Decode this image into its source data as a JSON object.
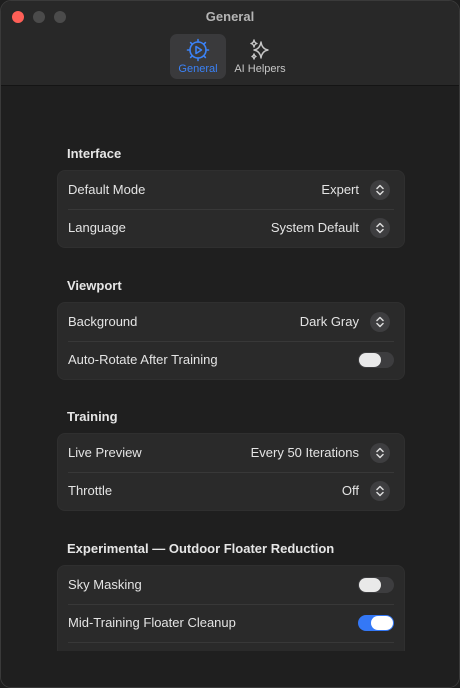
{
  "window": {
    "title": "General"
  },
  "tabs": [
    {
      "label": "General",
      "icon": "gear-icon",
      "active": true
    },
    {
      "label": "AI Helpers",
      "icon": "sparkles-icon",
      "active": false
    }
  ],
  "sections": {
    "interface": {
      "title": "Interface",
      "default_mode": {
        "label": "Default Mode",
        "value": "Expert"
      },
      "language": {
        "label": "Language",
        "value": "System Default"
      }
    },
    "viewport": {
      "title": "Viewport",
      "background": {
        "label": "Background",
        "value": "Dark Gray"
      },
      "auto_rotate": {
        "label": "Auto-Rotate After Training",
        "on": false
      }
    },
    "training": {
      "title": "Training",
      "live_preview": {
        "label": "Live Preview",
        "value": "Every 50 Iterations"
      },
      "throttle": {
        "label": "Throttle",
        "value": "Off"
      }
    },
    "experimental": {
      "title": "Experimental — Outdoor Floater Reduction",
      "sky_masking": {
        "label": "Sky Masking",
        "on": false
      },
      "floater_cleanup": {
        "label": "Mid-Training Floater Cleanup",
        "on": true
      }
    }
  },
  "colors": {
    "accent": "#3478f6",
    "close": "#fe5f57",
    "window_bg": "#1f1f1f",
    "group_bg": "#2a2a2a"
  }
}
